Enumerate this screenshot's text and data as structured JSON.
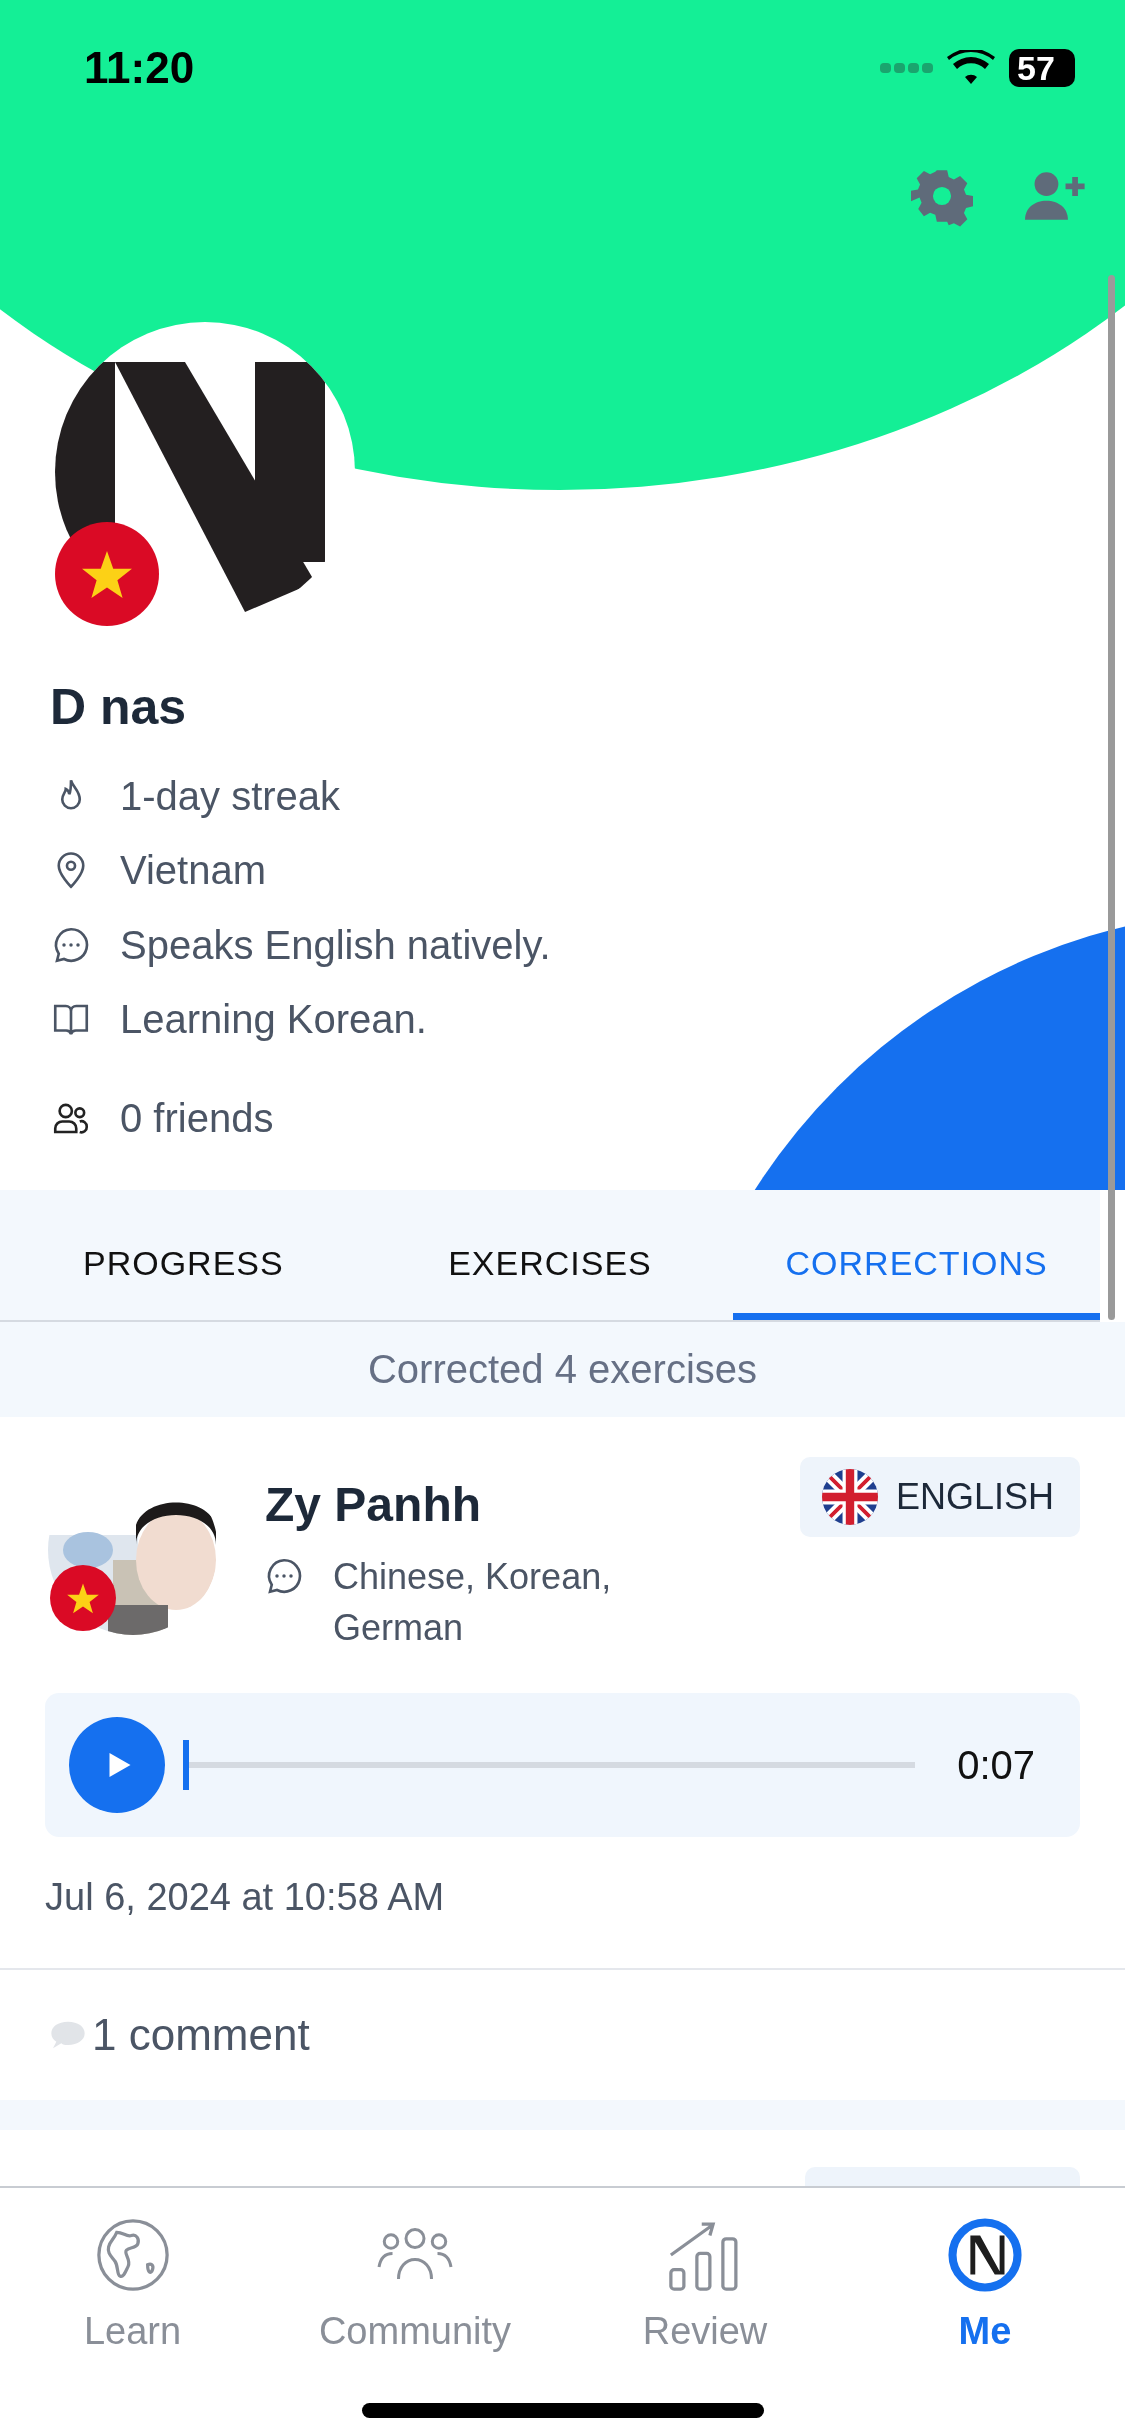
{
  "status_bar": {
    "time": "11:20",
    "battery": "57"
  },
  "profile": {
    "name": "D nas",
    "details": [
      {
        "kind": "streak",
        "text": "1-day streak"
      },
      {
        "kind": "location",
        "text": "Vietnam"
      },
      {
        "kind": "speaks",
        "text": "Speaks English natively."
      },
      {
        "kind": "learning",
        "text": "Learning Korean."
      }
    ],
    "friends": "0 friends"
  },
  "tabs": [
    {
      "label": "PROGRESS",
      "selected": false
    },
    {
      "label": "EXERCISES",
      "selected": false
    },
    {
      "label": "CORRECTIONS",
      "selected": true
    }
  ],
  "summary": "Corrected 4 exercises",
  "corrections": [
    {
      "name": "Zy Panhh",
      "languages": "Chinese, Korean, German",
      "language_badge": "ENGLISH",
      "audio": {
        "level": 0,
        "duration": "0:07"
      },
      "date": "Jul 6, 2024 at 10:58 AM",
      "comments": "1 comment"
    }
  ],
  "nav": [
    {
      "kind": "learn",
      "label": "Learn",
      "selected": false
    },
    {
      "kind": "community",
      "label": "Community",
      "selected": false
    },
    {
      "kind": "review",
      "label": "Review",
      "selected": false
    },
    {
      "kind": "me",
      "label": "Me",
      "selected": true
    }
  ]
}
